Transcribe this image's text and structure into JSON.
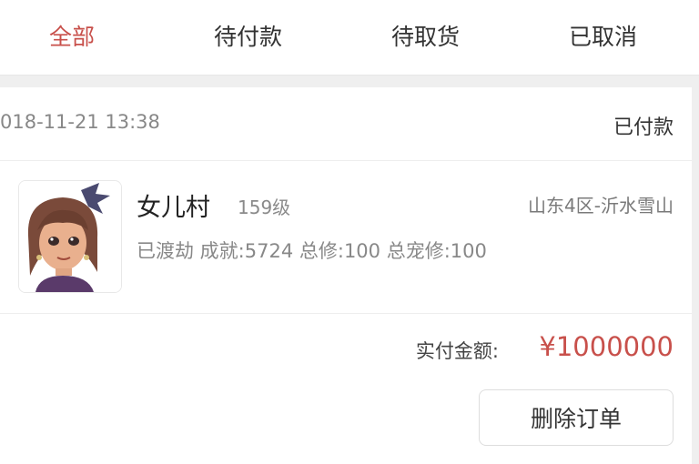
{
  "tabs": [
    {
      "label": "全部",
      "active": true
    },
    {
      "label": "待付款",
      "active": false
    },
    {
      "label": "待取货",
      "active": false
    },
    {
      "label": "已取消",
      "active": false
    }
  ],
  "order": {
    "time": "018-11-21 13:38",
    "status": "已付款",
    "item": {
      "name": "女儿村",
      "level": "159级",
      "server": "山东4区-沂水雪山",
      "desc": "已渡劫 成就:5724 总修:100 总宠修:100"
    },
    "paid_label": "实付金额:",
    "paid_amount": "¥1000000",
    "delete_label": "删除订单"
  },
  "colors": {
    "accent": "#c8504b",
    "text": "#333333",
    "muted": "#888888",
    "background": "#efefef"
  }
}
